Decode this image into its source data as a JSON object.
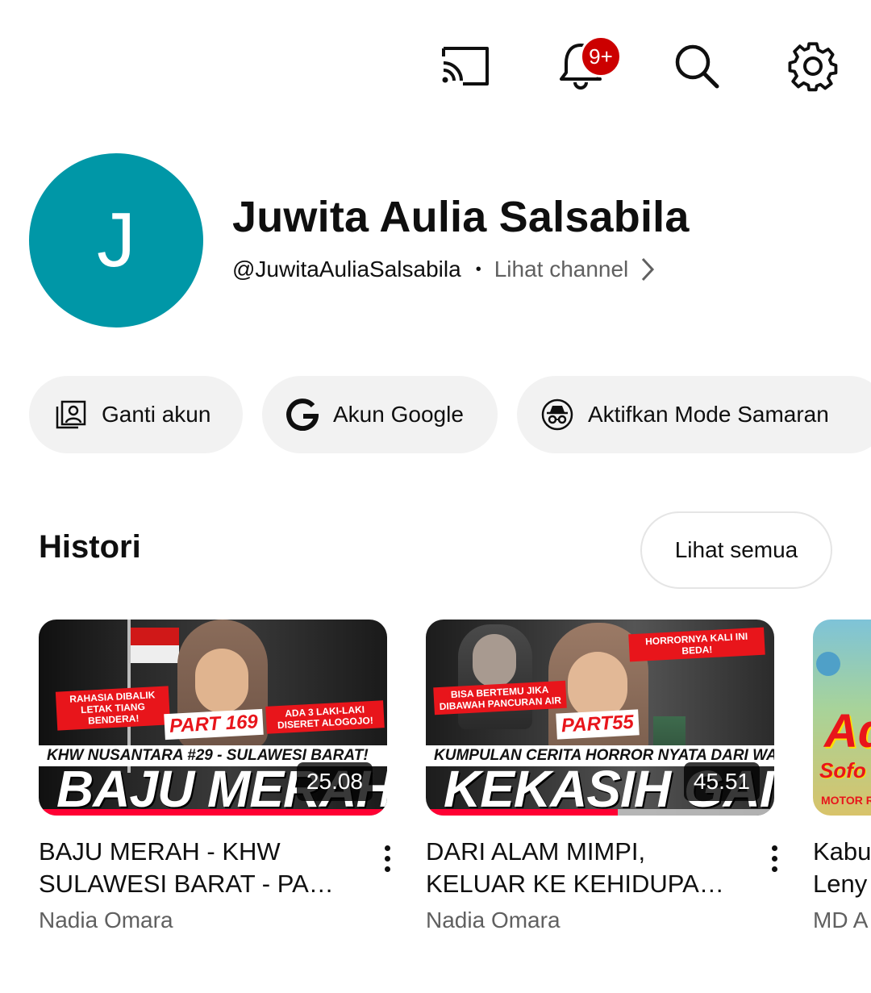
{
  "header": {
    "icons": [
      "cast-icon",
      "notifications-icon",
      "search-icon",
      "settings-icon"
    ],
    "notification_badge": "9+"
  },
  "profile": {
    "avatar_letter": "J",
    "avatar_color": "#0097a7",
    "name": "Juwita Aulia Salsabila",
    "handle": "@JuwitaAuliaSalsabila",
    "separator": "•",
    "view_channel": "Lihat channel"
  },
  "chips": [
    {
      "label": "Ganti akun",
      "icon": "switch-account-icon"
    },
    {
      "label": "Akun Google",
      "icon": "google-icon"
    },
    {
      "label": "Aktifkan Mode Samaran",
      "icon": "incognito-icon"
    }
  ],
  "history": {
    "title": "Histori",
    "see_all": "Lihat semua",
    "videos": [
      {
        "title_line1": "BAJU MERAH - KHW",
        "title_line2": "SULAWESI BARAT - PAR...",
        "channel": "Nadia Omara",
        "duration": "25.08",
        "progress": 1.0,
        "thumb": {
          "banner_left": "RAHASIA DIBALIK LETAK TIANG BENDERA!",
          "banner_right": "ADA 3 LAKI-LAKI DISERET ALOGOJO!",
          "part": "PART 169",
          "subtitle": "KHW NUSANTARA #29 - SULAWESI BARAT!",
          "big_text": "BAJU MERAH"
        }
      },
      {
        "title_line1": "DARI ALAM MIMPI,",
        "title_line2": "KELUAR KE KEHIDUPAN ...",
        "channel": "Nadia Omara",
        "duration": "45.51",
        "progress": 0.55,
        "thumb": {
          "banner_left": "BISA BERTEMU JIKA DIBAWAH PANCURAN AIR",
          "banner_right": "HORRORNYA KALI INI BEDA!",
          "part": "PART55",
          "subtitle": "KUMPULAN CERITA HORROR NYATA DARI WAWAK!",
          "big_text": "KEKASIH GAIB"
        }
      },
      {
        "title_line1": "Kabu",
        "title_line2": "Leny",
        "channel": "MD A",
        "thumb": {
          "big_text": "Ad",
          "sub": "Sofo",
          "bottom": "MOTOR R"
        }
      }
    ]
  },
  "colors": {
    "accent_red": "#ff0033",
    "badge_red": "#cc0000",
    "chip_bg": "#f2f2f2",
    "secondary_text": "#606060"
  }
}
